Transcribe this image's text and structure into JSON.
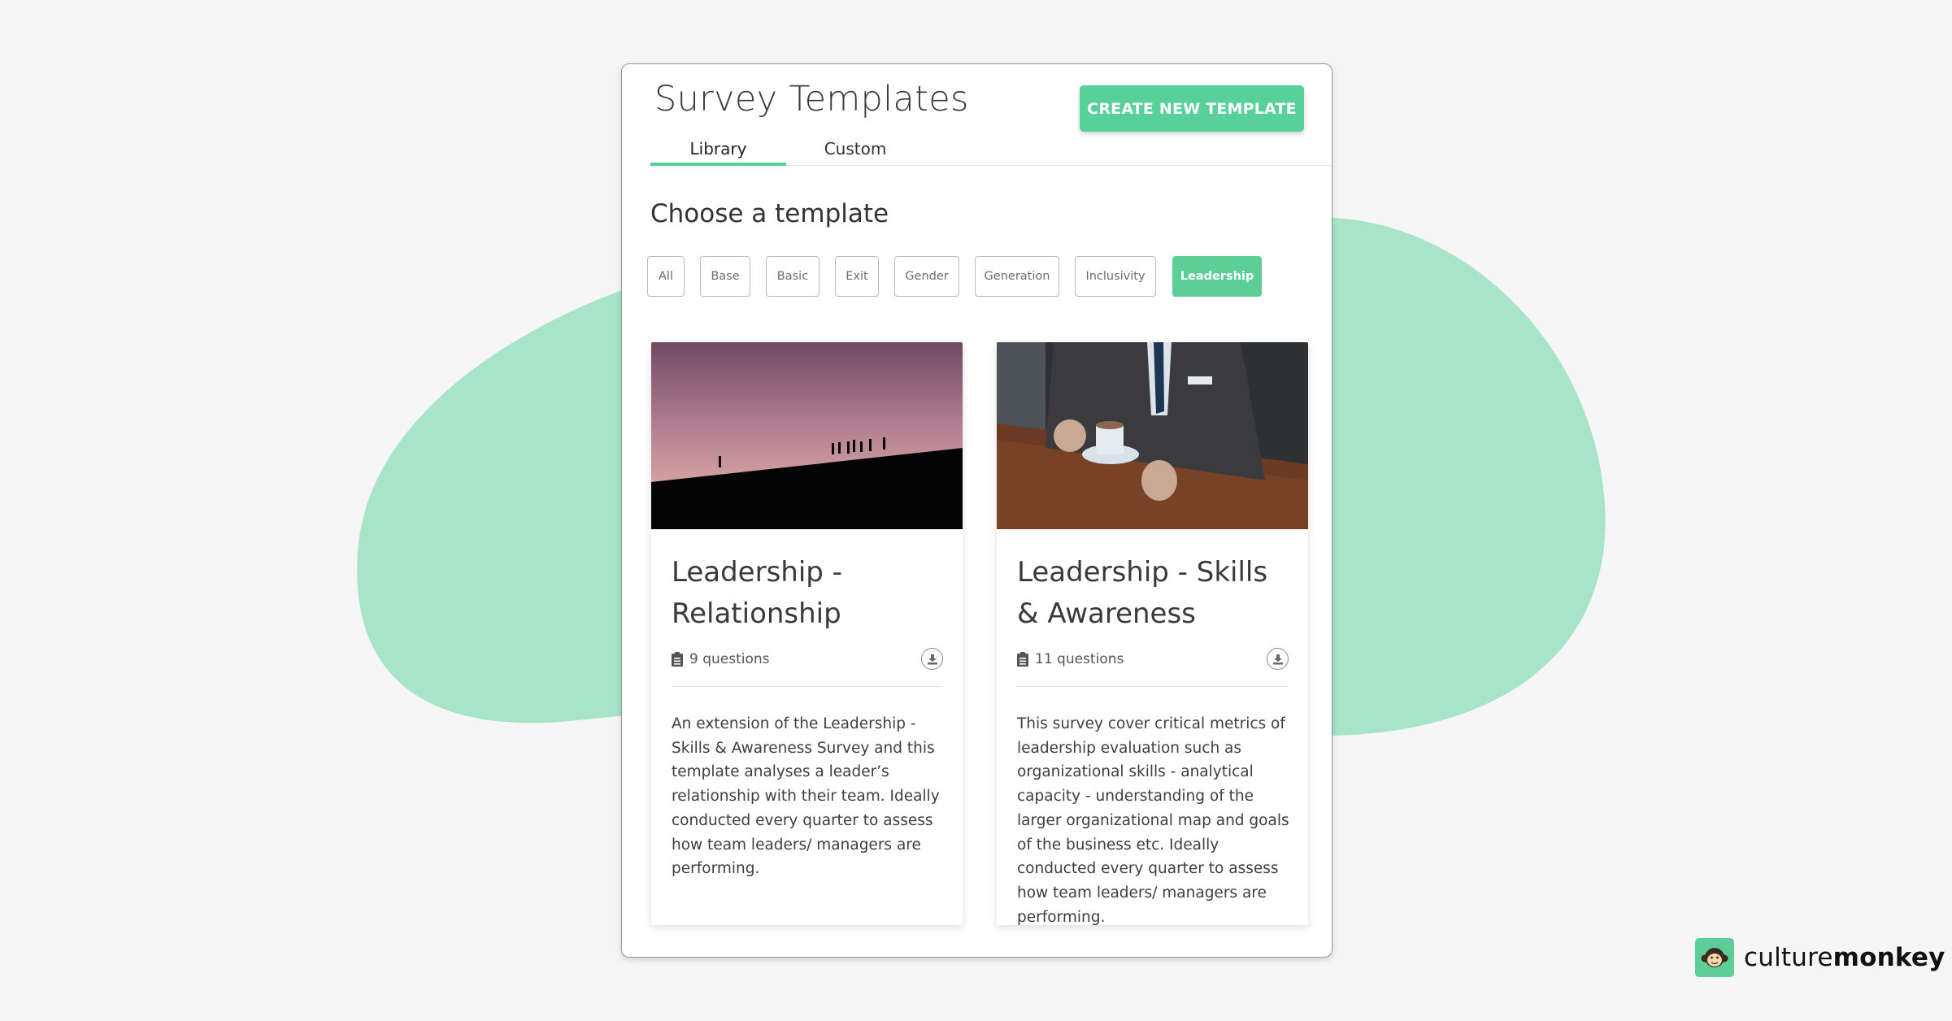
{
  "header": {
    "title": "Survey Templates",
    "create_button": "CREATE NEW TEMPLATE"
  },
  "tabs": [
    {
      "label": "Library",
      "active": true
    },
    {
      "label": "Custom",
      "active": false
    }
  ],
  "section_title": "Choose a template",
  "filters": [
    {
      "label": "All",
      "active": false
    },
    {
      "label": "Base",
      "active": false
    },
    {
      "label": "Basic",
      "active": false
    },
    {
      "label": "Exit",
      "active": false
    },
    {
      "label": "Gender",
      "active": false
    },
    {
      "label": "Generation",
      "active": false
    },
    {
      "label": "Inclusivity",
      "active": false
    },
    {
      "label": "Leadership",
      "active": true
    }
  ],
  "cards": [
    {
      "image": "silhouettes-walking-up-hill-at-dusk",
      "title": "Leadership - Relationship",
      "questions": "9 questions",
      "description": "An extension of the Leadership - Skills & Awareness Survey and this template analyses a leader’s relationship with their team. Ideally conducted every quarter to assess how team leaders/ managers are performing."
    },
    {
      "image": "businessman-in-suit-holding-coffee-cup",
      "title": "Leadership - Skills & Awareness",
      "questions": "11 questions",
      "description": "This survey cover critical metrics of leadership evaluation such as organizational skills - analytical capacity - understanding of the larger organizational map and goals of the business etc. Ideally conducted every quarter to assess how team leaders/ managers are performing."
    }
  ],
  "brand": {
    "name_light": "culture",
    "name_bold": "monkey",
    "accent": "#57d09a",
    "blob_color": "#a7e4c8"
  }
}
